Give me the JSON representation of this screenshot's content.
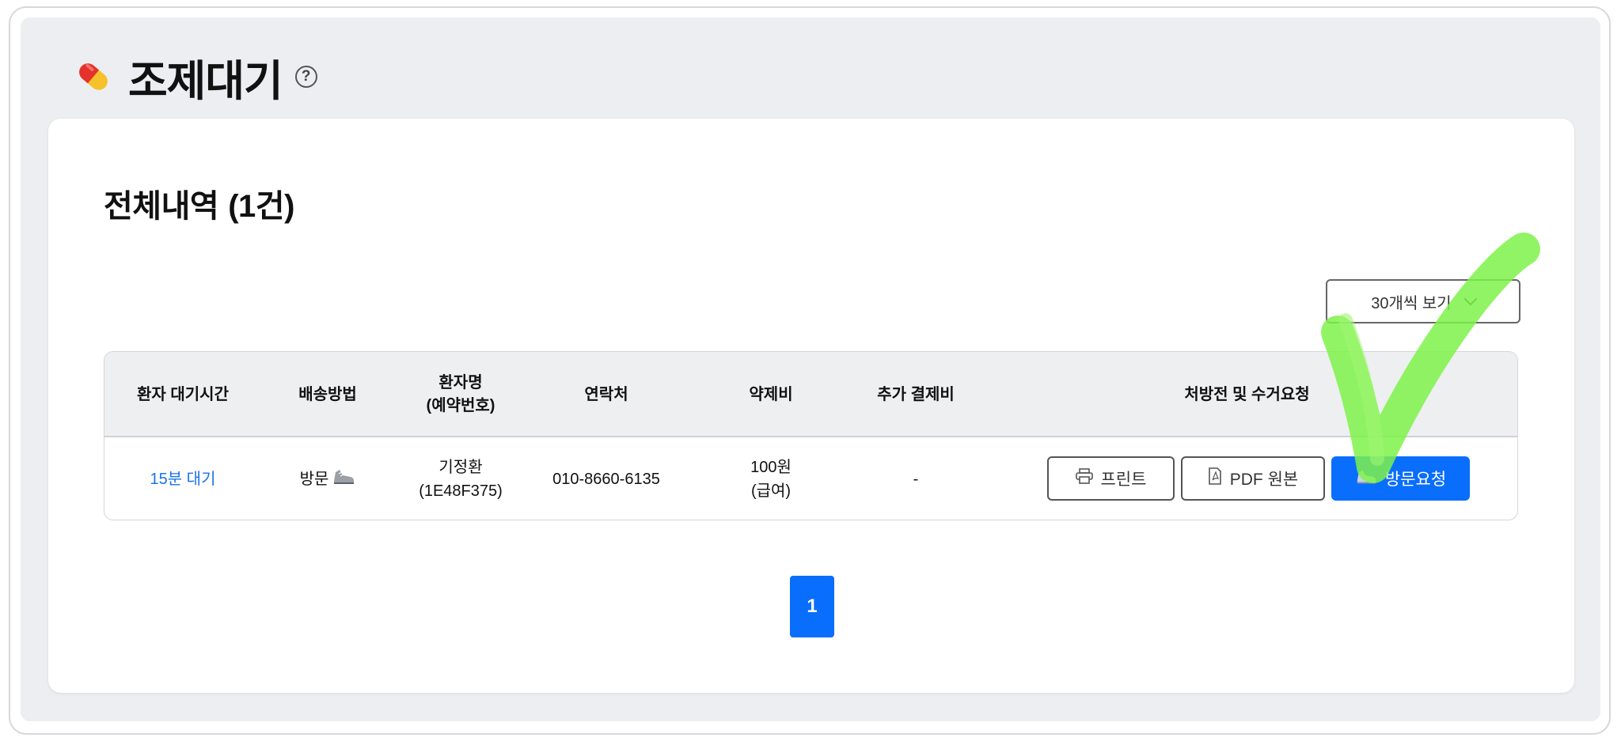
{
  "page": {
    "title": "조제대기",
    "help_symbol": "?"
  },
  "section": {
    "title": "전체내역",
    "count": "(1건)"
  },
  "per_page": {
    "label": "30개씩 보기"
  },
  "table": {
    "headers": {
      "wait_time": "환자 대기시간",
      "delivery": "배송방법",
      "patient_line1": "환자명",
      "patient_line2": "(예약번호)",
      "contact": "연락처",
      "fee": "약제비",
      "extra_fee": "추가 결제비",
      "actions": "처방전 및 수거요청"
    },
    "rows": [
      {
        "wait_time": "15분 대기",
        "delivery": "방문",
        "patient_name": "기정환",
        "reservation_no": "(1E48F375)",
        "contact": "010-8660-6135",
        "fee": "100원",
        "fee_type": "(급여)",
        "extra_fee": "-",
        "print_label": "프린트",
        "pdf_label": "PDF 원본",
        "visit_label": "방문요청"
      }
    ]
  },
  "pagination": {
    "current": "1"
  },
  "colors": {
    "primary": "#0a6efc",
    "link": "#1a73e8",
    "background": "#eceef1",
    "annotation": "#7ef24a"
  },
  "icons": [
    "pill-icon",
    "help-icon",
    "chevron-down-icon",
    "shoe-icon",
    "printer-icon",
    "pdf-icon",
    "checkmark-annotation"
  ]
}
